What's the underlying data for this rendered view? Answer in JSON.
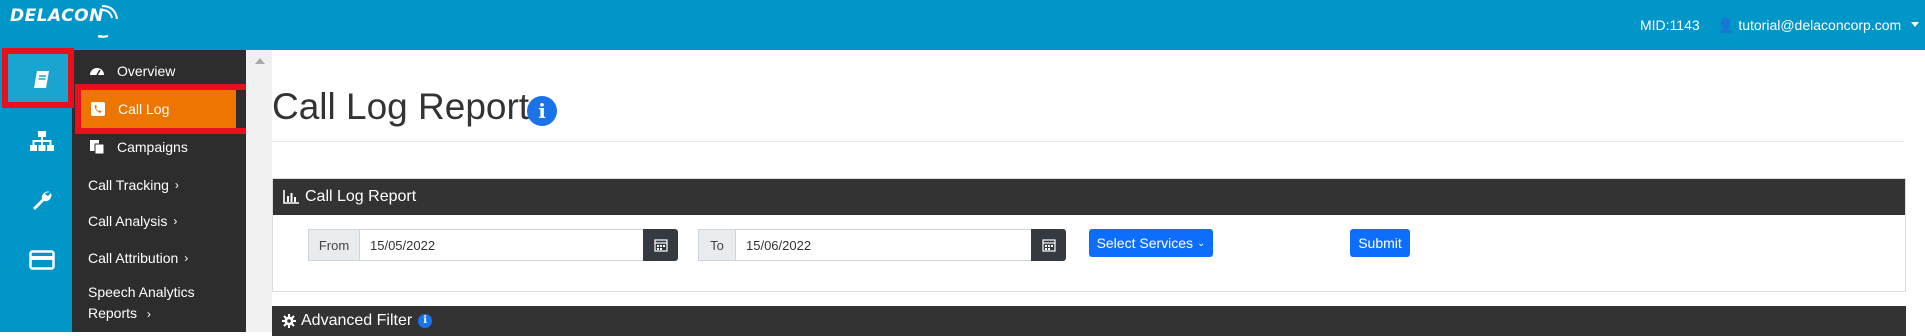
{
  "header": {
    "logo_text": "DELACON",
    "mid": "MID:1143",
    "user_email": "tutorial@delaconcorp.com"
  },
  "menu": {
    "overview": "Overview",
    "call_log": "Call Log",
    "campaigns": "Campaigns",
    "call_tracking": "Call Tracking",
    "call_analysis": "Call Analysis",
    "call_attribution": "Call Attribution",
    "speech_analytics_line1": "Speech Analytics",
    "speech_analytics_line2": "Reports",
    "chevron": "›"
  },
  "page": {
    "title": "Call Log Report",
    "info_glyph": "i"
  },
  "report_panel": {
    "title": "Call Log Report",
    "from_label": "From",
    "from_value": "15/05/2022",
    "to_label": "To",
    "to_value": "15/06/2022",
    "select_services": "Select Services",
    "submit": "Submit"
  },
  "advanced_panel": {
    "title": "Advanced Filter"
  },
  "colors": {
    "brand": "#0096c7",
    "active_menu": "#ee7600",
    "highlight": "#e8101c",
    "button": "#0d6efd"
  }
}
